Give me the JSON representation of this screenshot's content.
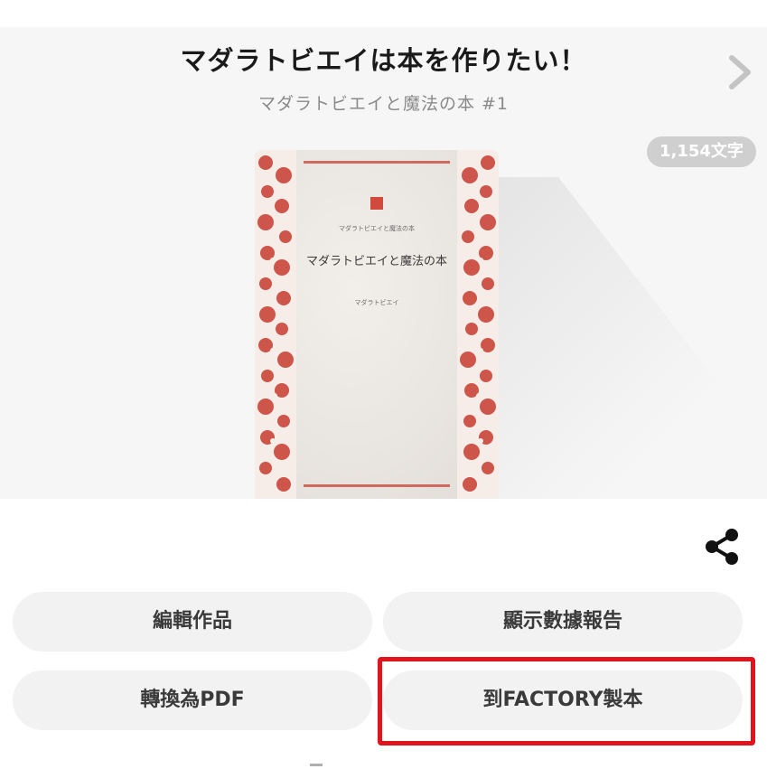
{
  "work": {
    "title": "マダラトビエイは本を作りたい！",
    "series": "マダラトビエイと魔法の本 #1",
    "char_count": "1,154文字"
  },
  "cover": {
    "small_heading": "マダラトビエイと魔法の本",
    "title": "マダラトビエイと魔法の本",
    "author": "マダラトビエイ"
  },
  "icons": {
    "next": "chevron-right-icon",
    "share": "share-icon"
  },
  "actions": {
    "edit": "編輯作品",
    "stats": "顯示數據報告",
    "pdf": "轉換為PDF",
    "factory": "到FACTORY製本"
  },
  "colors": {
    "hero_bg": "#f6f6f6",
    "button_bg": "#f2f2f2",
    "badge_bg": "#cfcfcf",
    "highlight": "#e0141e",
    "cover_red": "#cc4a3c"
  }
}
